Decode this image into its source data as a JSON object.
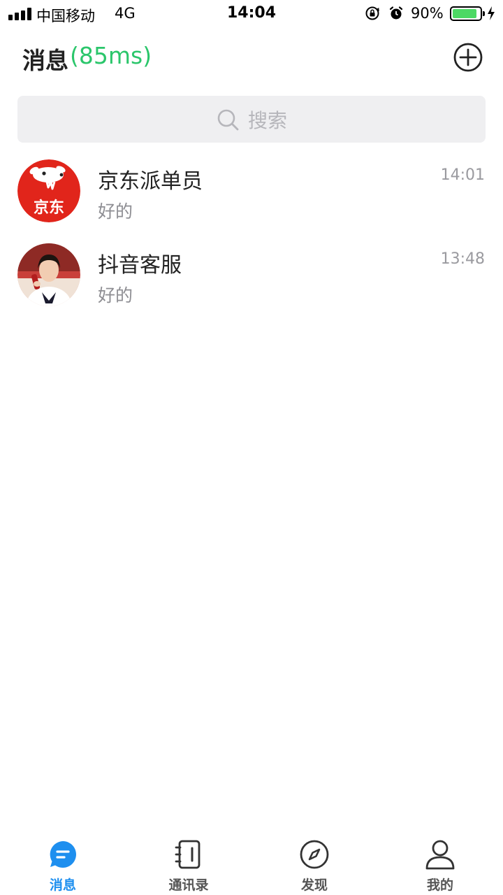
{
  "status_bar": {
    "carrier": "中国移动",
    "network": "4G",
    "time": "14:04",
    "battery_percent": "90%",
    "battery_level": 0.9
  },
  "header": {
    "title": "消息",
    "latency": "(85ms)",
    "add_icon": "plus-circle-icon"
  },
  "search": {
    "placeholder": "搜索",
    "icon": "search-icon"
  },
  "conversations": [
    {
      "name": "京东派单员",
      "preview": "好的",
      "time": "14:01",
      "avatar_text": "京东"
    },
    {
      "name": "抖音客服",
      "preview": "好的",
      "time": "13:48"
    }
  ],
  "tabs": [
    {
      "label": "消息",
      "icon": "chat-bubble-icon",
      "active": true
    },
    {
      "label": "通讯录",
      "icon": "contacts-book-icon",
      "active": false
    },
    {
      "label": "发现",
      "icon": "compass-icon",
      "active": false
    },
    {
      "label": "我的",
      "icon": "person-icon",
      "active": false
    }
  ],
  "colors": {
    "accent_blue": "#1e8fef",
    "latency_green": "#2bc66b",
    "jd_red": "#e1251b"
  }
}
